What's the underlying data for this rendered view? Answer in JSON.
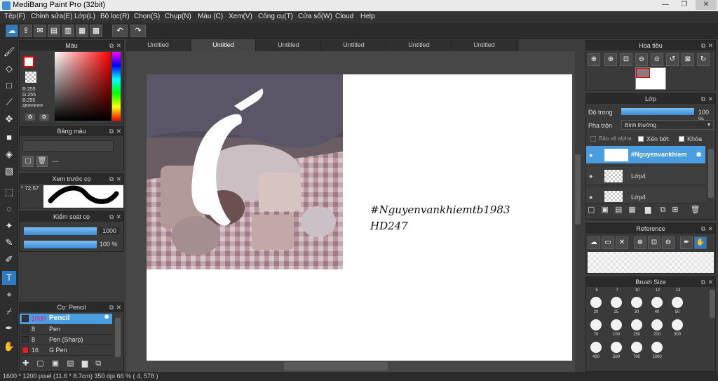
{
  "window": {
    "title": "MediBang Paint Pro (32bit)",
    "minimize": "—",
    "maximize": "❐",
    "close": "✕"
  },
  "menu": [
    "Tệp(F)",
    "Chỉnh sửa(E)",
    "Lớp(L)",
    "Bộ lọc(R)",
    "Chọn(S)",
    "Chụp(N)",
    "Màu (C)",
    "Xem(V)",
    "Công cụ(T)",
    "Cửa sổ(W)",
    "Cloud",
    "Help"
  ],
  "tabs": [
    "Untitled",
    "Untitled",
    "Untitled",
    "Untitled",
    "Untitled",
    "Untitled"
  ],
  "color_panel": {
    "title": "Màu",
    "r": "R:255",
    "g": "G:255",
    "b": "B:255",
    "hex": "#FFFFFF",
    "accent": "#ff0000"
  },
  "palette_panel": {
    "title": "Bảng màu",
    "value": "---"
  },
  "brush_preview": {
    "title": "Xem trước cọ",
    "size": "* 72.57"
  },
  "brush_control": {
    "title": "Kiểm soát cọ",
    "size": "1000",
    "opacity": "100 %"
  },
  "brush_list": {
    "title": "Cọ: Pencil",
    "items": [
      {
        "size": "1000",
        "name": "Pencil",
        "color": "#333333"
      },
      {
        "size": "8",
        "name": "Pen",
        "color": "#333333"
      },
      {
        "size": "8",
        "name": "Pen (Sharp)",
        "color": "#333333"
      },
      {
        "size": "16",
        "name": "G Pen",
        "color": "#e02020"
      }
    ]
  },
  "canvas": {
    "text_line1": "#Nguyenvankhiemtb1983",
    "text_line2": "HD247"
  },
  "navigator": {
    "title": "Hoa tiêu"
  },
  "layer_panel": {
    "title": "Lớp",
    "opacity_label": "Độ trong",
    "opacity_value": "100 %",
    "blend_label": "Pha trộn",
    "blend_value": "Bình thường",
    "protect_alpha": "Bảo vệ alpha",
    "clipping": "Xén bớt",
    "lock": "Khóa",
    "layers": [
      "#Nguyenvankhiem",
      "Lớp4",
      "Lớp4"
    ]
  },
  "reference": {
    "title": "Reference"
  },
  "brush_size": {
    "title": "Brush Size",
    "top": [
      "5",
      "7",
      "10",
      "12",
      "13"
    ],
    "sizes": [
      "20",
      "25",
      "30",
      "40",
      "50",
      "70",
      "100",
      "150",
      "200",
      "300",
      "400",
      "500",
      "700",
      "1000"
    ]
  },
  "status": "1600 * 1200 pixel   (11.6 * 8.7cm)   350 dpi   66 %   ( 4, 578 )"
}
